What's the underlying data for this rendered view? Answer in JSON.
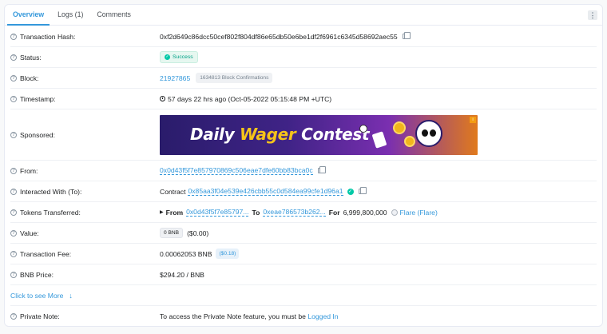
{
  "tabs": [
    {
      "label": "Overview"
    },
    {
      "label": "Logs (1)"
    },
    {
      "label": "Comments"
    }
  ],
  "menu_icon": "ellipsis-vertical-icon",
  "rows": {
    "tx_hash": {
      "label": "Transaction Hash:",
      "value": "0xf2d649c86dcc50cef802f804df86e65db50e6be1df2f6961c6345d58692aec55"
    },
    "status": {
      "label": "Status:",
      "value": "Success"
    },
    "block": {
      "label": "Block:",
      "number": "21927865",
      "confirmations": "1634813 Block Confirmations"
    },
    "timestamp": {
      "label": "Timestamp:",
      "value": "57 days 22 hrs ago (Oct-05-2022 05:15:48 PM +UTC)"
    },
    "sponsored": {
      "label": "Sponsored:",
      "banner_word1": "Daily ",
      "banner_word2": "Wager",
      "banner_word3": " Contest"
    },
    "from": {
      "label": "From:",
      "value": "0x0d43f5f7e857970869c506eae7dfe60bb83bca0c"
    },
    "interacted": {
      "label": "Interacted With (To):",
      "prefix": "Contract",
      "value": "0x85aa3f04e539e426cbb55c0d584ea99cfe1d96a1"
    },
    "tokens": {
      "label": "Tokens Transferred:",
      "from_label": "From",
      "from_value": "0x0d43f5f7e85797...",
      "to_label": "To",
      "to_value": "0xeae786573b262...",
      "for_label": "For",
      "amount": "6,999,800,000",
      "token": "Flare (Flare)"
    },
    "value": {
      "label": "Value:",
      "badge": "0 BNB",
      "usd": "($0.00)"
    },
    "fee": {
      "label": "Transaction Fee:",
      "value": "0.00062053 BNB",
      "usd": "($0.18)"
    },
    "price": {
      "label": "BNB Price:",
      "value": "$294.20 / BNB"
    },
    "private_note": {
      "label": "Private Note:",
      "text": "To access the Private Note feature, you must be ",
      "link": "Logged In"
    }
  },
  "see_more": "Click to see More",
  "colors": {
    "accent": "#3498db",
    "success": "#00c9a7"
  }
}
